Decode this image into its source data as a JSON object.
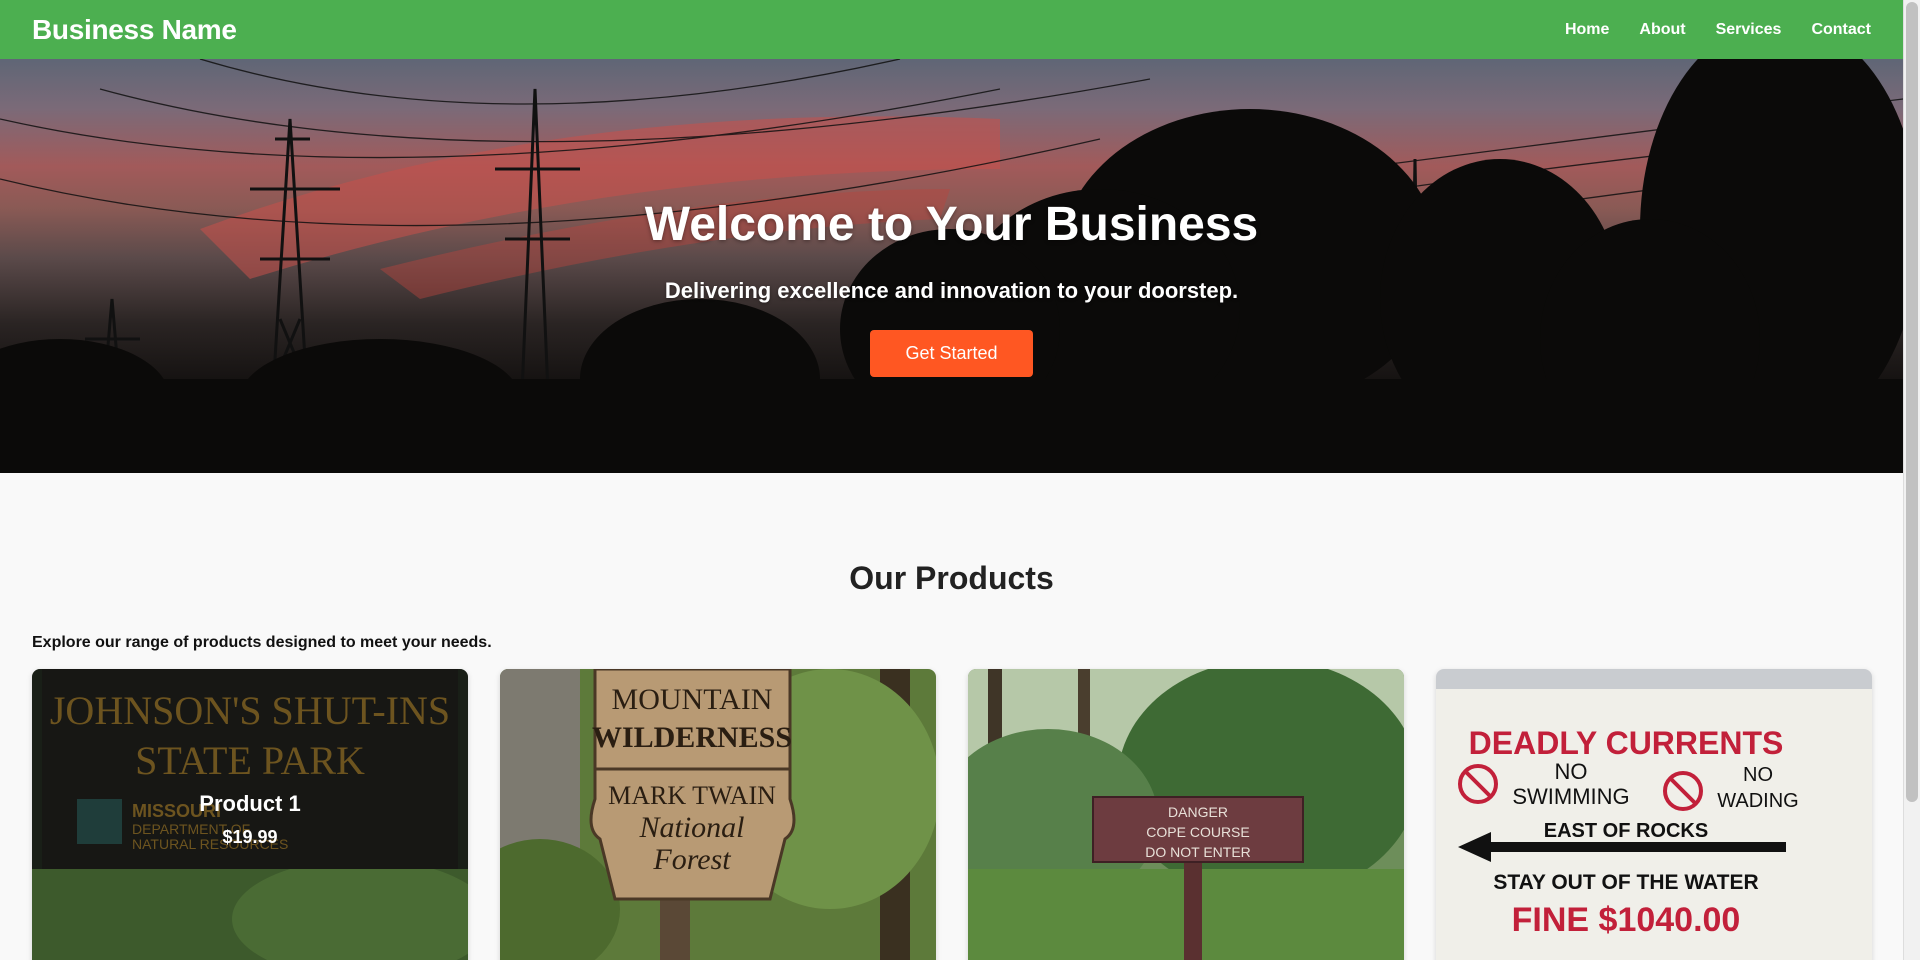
{
  "header": {
    "brand": "Business Name",
    "nav": [
      "Home",
      "About",
      "Services",
      "Contact"
    ],
    "bg_color": "#4caf50"
  },
  "hero": {
    "title": "Welcome to Your Business",
    "subtitle": "Delivering excellence and innovation to your doorstep.",
    "cta_label": "Get Started",
    "cta_color": "#ff5722"
  },
  "products": {
    "title": "Our Products",
    "description": "Explore our range of products designed to meet your needs.",
    "items": [
      {
        "name": "Product 1",
        "price": "$19.99",
        "sign_lines": [
          "JOHNSON'S SHUT-INS",
          "STATE PARK",
          "MISSOURI",
          "DEPARTMENT OF",
          "NATURAL RESOURCES"
        ]
      },
      {
        "sign_lines": [
          "MOUNTAIN",
          "WILDERNESS",
          "MARK TWAIN",
          "National",
          "Forest"
        ]
      },
      {
        "sign_lines": [
          "DANGER",
          "COPE COURSE",
          "DO NOT ENTER"
        ]
      },
      {
        "sign_lines": [
          "DEADLY CURRENTS",
          "NO",
          "SWIMMING",
          "NO",
          "WADING",
          "EAST OF ROCKS",
          "STAY OUT OF THE WATER",
          "FINE $1040.00"
        ]
      }
    ]
  }
}
